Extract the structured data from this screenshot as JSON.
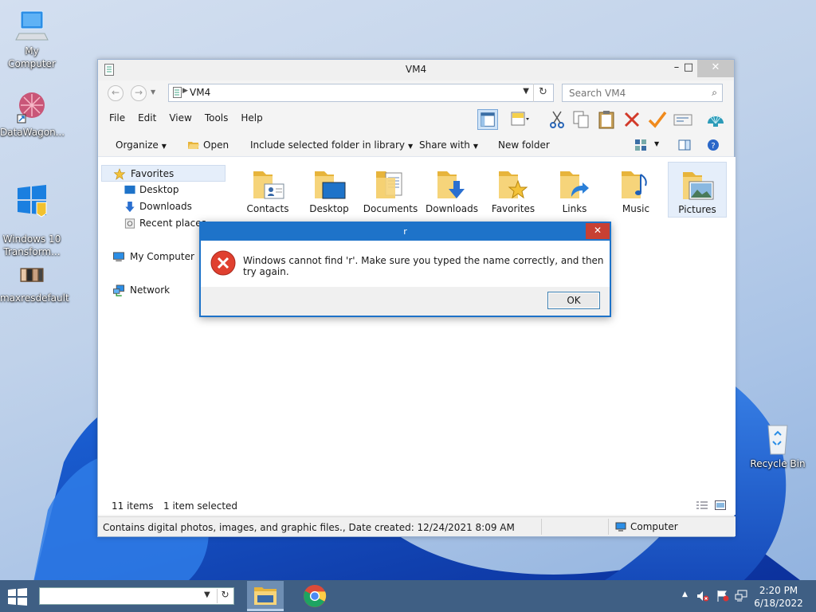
{
  "desktop": {
    "icons": [
      {
        "label": "My Computer"
      },
      {
        "label": "DataWagon..."
      },
      {
        "label": "Windows 10\nTransform..."
      },
      {
        "label": "maxresdefault"
      },
      {
        "label": "Recycle Bin"
      }
    ]
  },
  "explorer": {
    "title": "VM4",
    "address": {
      "crumb": "VM4"
    },
    "search": {
      "placeholder": "Search VM4"
    },
    "menu": [
      "File",
      "Edit",
      "View",
      "Tools",
      "Help"
    ],
    "commands": {
      "organize": "Organize",
      "open": "Open",
      "include": "Include selected folder in library",
      "share": "Share with",
      "new_folder": "New folder"
    },
    "nav": {
      "favorites": "Favorites",
      "desktop": "Desktop",
      "downloads": "Downloads",
      "recent": "Recent places",
      "my_computer": "My Computer",
      "network": "Network"
    },
    "folders": [
      "Contacts",
      "Desktop",
      "Documents",
      "Downloads",
      "Favorites",
      "Links",
      "Music",
      "Pictures"
    ],
    "selected_folder": "Pictures",
    "items_count": "11 items",
    "selected_count": "1 item selected",
    "status_message": "Contains digital photos, images, and graphic files., Date created: 12/24/2021 8:09 AM",
    "status_zone": "Computer"
  },
  "dialog": {
    "title": "r",
    "message": "Windows cannot find 'r'. Make sure you typed the name correctly, and then try again.",
    "ok_label": "OK",
    "close_label": "✕"
  },
  "taskbar": {
    "time": "2:20 PM",
    "date": "6/18/2022"
  },
  "colors": {
    "accent": "#1e73c9",
    "taskbar": "#3f5f84",
    "error_red": "#e0402f",
    "folder_yellow": "#f6c644"
  }
}
